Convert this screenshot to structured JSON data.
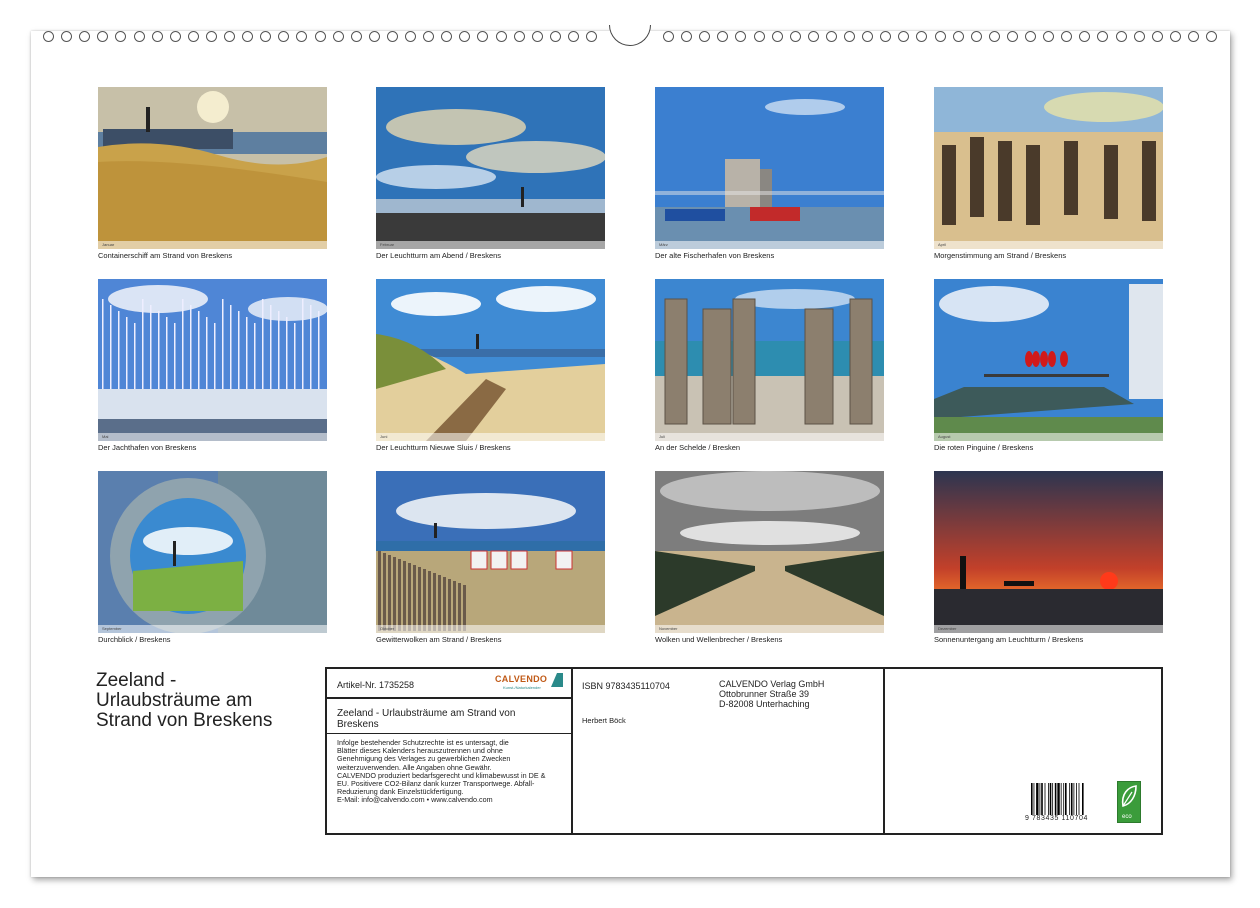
{
  "photos": [
    {
      "caption": "Containerschiff am Strand von Breskens",
      "month": "Januar",
      "scene": "dunes-lighthouse",
      "colors": {
        "sky": "#c7c0a8",
        "ground": "#c9a24a"
      }
    },
    {
      "caption": "Der Leuchtturm am Abend / Breskens",
      "month": "Februar",
      "scene": "cloud-sky",
      "colors": {
        "sky": "#2f73b8",
        "ground": "#3a3a3a"
      }
    },
    {
      "caption": "Der alte Fischerhafen von Breskens",
      "month": "März",
      "scene": "harbor",
      "colors": {
        "sky": "#3b7fd0",
        "ground": "#6a8fb0"
      }
    },
    {
      "caption": "Morgenstimmung am Strand / Breskens",
      "month": "April",
      "scene": "posts-beach",
      "colors": {
        "sky": "#8fb6d8",
        "ground": "#d9bf8e"
      }
    },
    {
      "caption": "Der Jachthafen von Breskens",
      "month": "Mai",
      "scene": "marina",
      "colors": {
        "sky": "#4f86d6",
        "ground": "#d9e2ee"
      }
    },
    {
      "caption": "Der Leuchtturm Nieuwe Sluis / Breskens",
      "month": "Juni",
      "scene": "dune-grass",
      "colors": {
        "sky": "#3f8bd4",
        "ground": "#e3cf9c"
      }
    },
    {
      "caption": "An der Schelde / Bresken",
      "month": "Juli",
      "scene": "posts-sea",
      "colors": {
        "sky": "#3c86d0",
        "ground": "#c9c2b4"
      }
    },
    {
      "caption": "Die roten Pinguine / Breskens",
      "month": "August",
      "scene": "penguins",
      "colors": {
        "sky": "#3a83d0",
        "ground": "#5f8a4c"
      }
    },
    {
      "caption": "Durchblick / Breskens",
      "month": "September",
      "scene": "porthole",
      "colors": {
        "sky": "#5a7fae",
        "ground": "#7a8a8e"
      }
    },
    {
      "caption": "Gewitterwolken am Strand / Breskens",
      "month": "Oktober",
      "scene": "beach-huts",
      "colors": {
        "sky": "#3a6fb8",
        "ground": "#b8a77a"
      }
    },
    {
      "caption": "Wolken und Wellenbrecher / Breskens",
      "month": "November",
      "scene": "breakwater",
      "colors": {
        "sky": "#7d7d7d",
        "ground": "#c9b48e"
      }
    },
    {
      "caption": "Sonnenuntergang am Leuchtturm / Breskens",
      "month": "Dezember",
      "scene": "sunset",
      "colors": {
        "sky": "#c2402a",
        "ground": "#2a2a30"
      }
    }
  ],
  "title_lines": [
    "Zeeland -",
    "Urlaubsträume am",
    "Strand von Breskens"
  ],
  "info": {
    "article": "Artikel-Nr. 1735258",
    "brand": "CALVENDO",
    "brand_sub": "Kunst-/Naturkalender",
    "title_lines": [
      "Zeeland - Urlaubsträume am Strand von",
      "Breskens"
    ],
    "legal_lines": [
      "Infolge bestehender Schutzrechte ist es untersagt, die",
      "Blätter dieses Kalenders herauszutrennen und ohne",
      "Genehmigung des Verlages zu gewerblichen Zwecken",
      "weiterzuverwenden. Alle Angaben ohne Gewähr.",
      "CALVENDO produziert bedarfsgerecht und klimabewusst in DE &",
      "EU. Positivere CO2-Bilanz dank kurzer Transportwege. Abfall-",
      "Reduzierung dank Einzelstückfertigung.",
      "E-Mail: info@calvendo.com • www.calvendo.com"
    ],
    "isbn": "ISBN 9783435110704",
    "author": "Herbert Böck",
    "publisher_lines": [
      "CALVENDO Verlag GmbH",
      "Ottobrunner Straße 39",
      "D-82008 Unterhaching"
    ],
    "barcode_number": "9 783435 110704",
    "eco_label": "eco"
  }
}
